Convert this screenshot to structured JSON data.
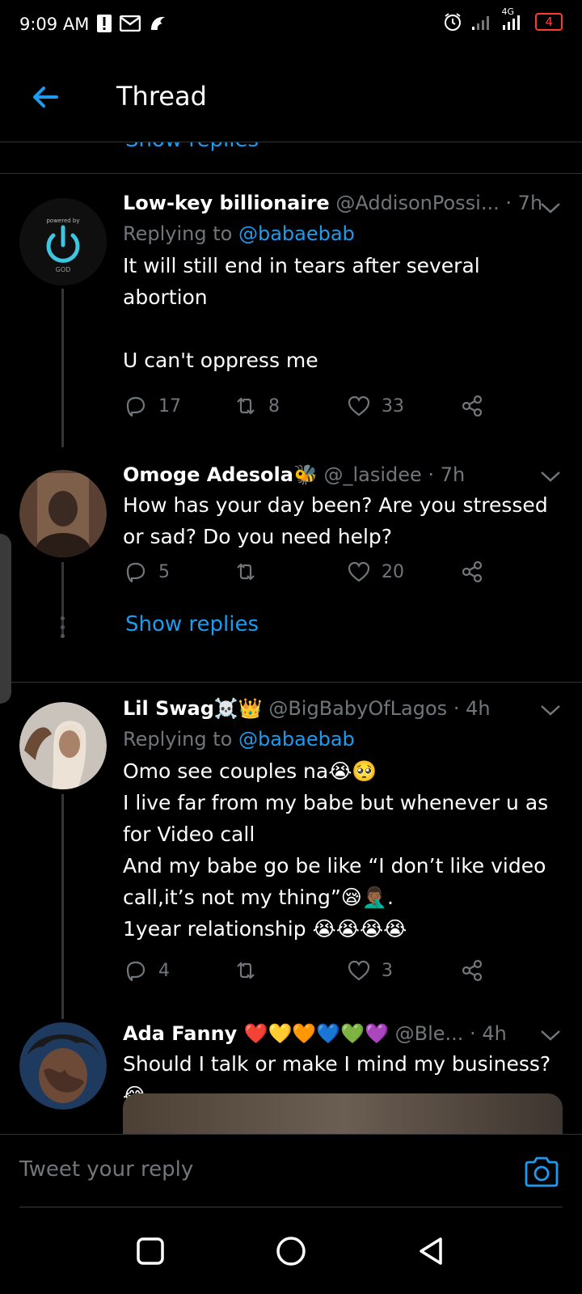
{
  "status_bar": {
    "time": "9:09 AM",
    "network_label": "4G",
    "battery_level": "4",
    "left_icons": [
      "alert-icon",
      "mail-icon",
      "app-notification-icon"
    ],
    "right_icons": [
      "alarm-icon",
      "signal-icon",
      "signal-4g-icon",
      "battery-icon"
    ]
  },
  "header": {
    "title": "Thread",
    "back_icon": "arrow-left-icon",
    "accent_color": "#1d9bf0"
  },
  "feed": {
    "peek_show_replies": "Show replies",
    "tweets": [
      {
        "name": "Low-key billionaire",
        "handle": "@AddisonPossi...",
        "separator": "·",
        "age": "7h",
        "replying_label": "Replying to",
        "replying_to": "@babaebab",
        "text": "It will still end in tears after several abortion\n\nU can't oppress me",
        "avatar_text_top": "powered by",
        "avatar_text_bottom": "GOD",
        "reply_count": "17",
        "retweet_count": "8",
        "like_count": "33"
      },
      {
        "name": "Omoge Adesola🐝",
        "handle": "@_lasidee",
        "separator": "·",
        "age": "7h",
        "text": "How has your day been? Are you stressed or sad? Do you need help?",
        "reply_count": "5",
        "retweet_count": "",
        "like_count": "20",
        "show_replies": "Show replies"
      },
      {
        "name": "Lil Swag☠️👑",
        "handle": "@BigBabyOfLagos",
        "separator": "·",
        "age": "4h",
        "replying_label": "Replying to",
        "replying_to": "@babaebab",
        "text": "Omo see couples na😭🥺\nI live far from my babe but whenever u as for Video call\nAnd my babe go be like “I don’t like video call,it’s not my thing”😪🤦🏾‍♂️.\n1year relationship 😭😭😭😭",
        "reply_count": "4",
        "retweet_count": "",
        "like_count": "3"
      },
      {
        "name": "Ada Fanny ❤️💛🧡💙💚💜",
        "handle": "@Ble...",
        "separator": "·",
        "age": "4h",
        "text": "Should I talk or make I mind my business?😂"
      }
    ]
  },
  "composer": {
    "placeholder": "Tweet your reply",
    "camera_icon": "camera-icon"
  },
  "navbar": {
    "icons": [
      "recents-square-icon",
      "home-circle-icon",
      "back-triangle-icon"
    ]
  }
}
